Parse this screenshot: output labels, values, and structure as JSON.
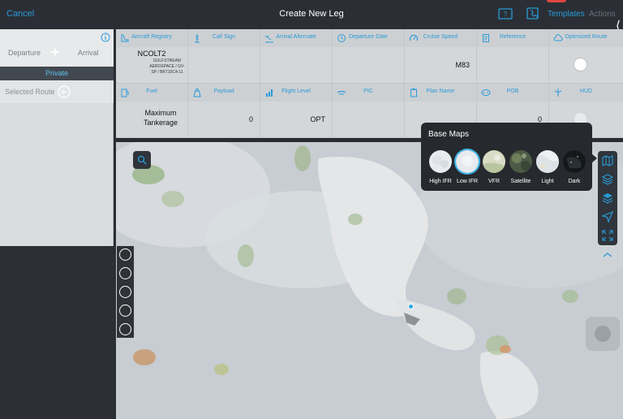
{
  "topbar": {
    "cancel_label": "Cancel",
    "title": "Create New Leg",
    "templates_label": "Templates",
    "actions_label": "Actions",
    "icons": [
      "question-icon",
      "phone-icon"
    ]
  },
  "left_panel": {
    "departure_label": "Departure",
    "arrival_label": "Arrival",
    "private_label": "Private",
    "selected_route_label": "Selected Route"
  },
  "flight_fields": [
    {
      "label": "Aircraft Registry",
      "value": "NCOLT2",
      "sub": "GULFSTREAM AEROSPACE / GV-SP / BR710C4-11",
      "icon": "aircraft-tail-icon"
    },
    {
      "label": "Call Sign",
      "value": "",
      "icon": "tower-icon"
    },
    {
      "label": "Arrival Alternate",
      "value": "",
      "icon": "landing-icon"
    },
    {
      "label": "Departure Date",
      "value": "",
      "icon": "calendar-icon"
    },
    {
      "label": "Cruise Speed",
      "value": "M83",
      "icon": "gauge-icon"
    },
    {
      "label": "Reference",
      "value": "",
      "icon": "document-icon"
    },
    {
      "label": "Optimized Route",
      "value": "on",
      "icon": "cloud-icon"
    },
    {
      "label": "Fuel",
      "value": "Maximum Tankerage",
      "icon": "fuel-icon"
    },
    {
      "label": "Payload",
      "value": "0",
      "icon": "weight-icon"
    },
    {
      "label": "Flight Level",
      "value": "OPT",
      "icon": "bars-icon"
    },
    {
      "label": "PIC",
      "value": "",
      "icon": "pilot-icon"
    },
    {
      "label": "Plan Name",
      "value": "",
      "icon": "clipboard-icon"
    },
    {
      "label": "POB",
      "value": "0",
      "icon": "people-icon"
    },
    {
      "label": "HUD",
      "value": "off",
      "icon": "hud-icon"
    }
  ],
  "base_maps": {
    "title": "Base Maps",
    "options": [
      "High IFR",
      "Low IFR",
      "VFR",
      "Satellite",
      "Light",
      "Dark"
    ],
    "selected": "Low IFR"
  },
  "map_controls": [
    "map-icon",
    "layers-icon",
    "weather-layers-icon",
    "navigate-icon",
    "expand-icon"
  ],
  "colors": {
    "accent": "#2b9bd8",
    "topbar_bg": "#2b2f35",
    "panel_bg": "#26292d",
    "selected_ring": "#3fb9ec",
    "location_dot": "#2aa8e0"
  }
}
